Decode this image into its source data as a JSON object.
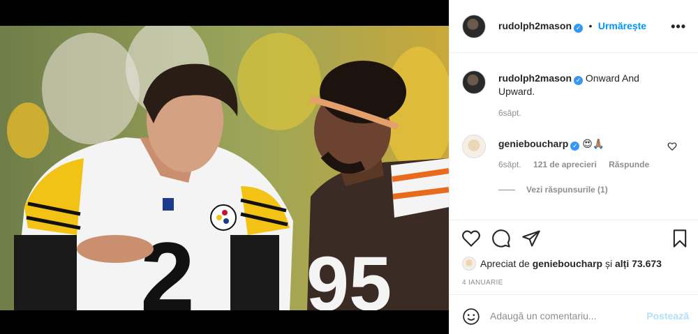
{
  "post": {
    "username": "rudolph2mason",
    "separator": "•",
    "follow_label": "Urmărește",
    "more_label": "•••"
  },
  "caption": {
    "username": "rudolph2mason",
    "text": "Onward And Upward.",
    "time": "6săpt."
  },
  "comments": [
    {
      "username": "genieboucharp",
      "text": "😍🙏🏽",
      "time": "6săpt.",
      "likes": "121 de aprecieri",
      "reply_label": "Răspunde",
      "view_replies": "Vezi răspunsurile (1)"
    }
  ],
  "likes": {
    "prefix": "Apreciat de",
    "user": "genieboucharp",
    "suffix": "și",
    "others": "alți 73.673"
  },
  "date": "4 IANUARIE",
  "add_comment": {
    "placeholder": "Adaugă un comentariu...",
    "post_label": "Postează"
  },
  "photo_jerseys": [
    "2",
    "95"
  ],
  "colors": {
    "link_blue": "#0095f6",
    "post_disabled": "#b2dffc",
    "verified": "#3897f0",
    "muted": "#8e8e8e"
  }
}
